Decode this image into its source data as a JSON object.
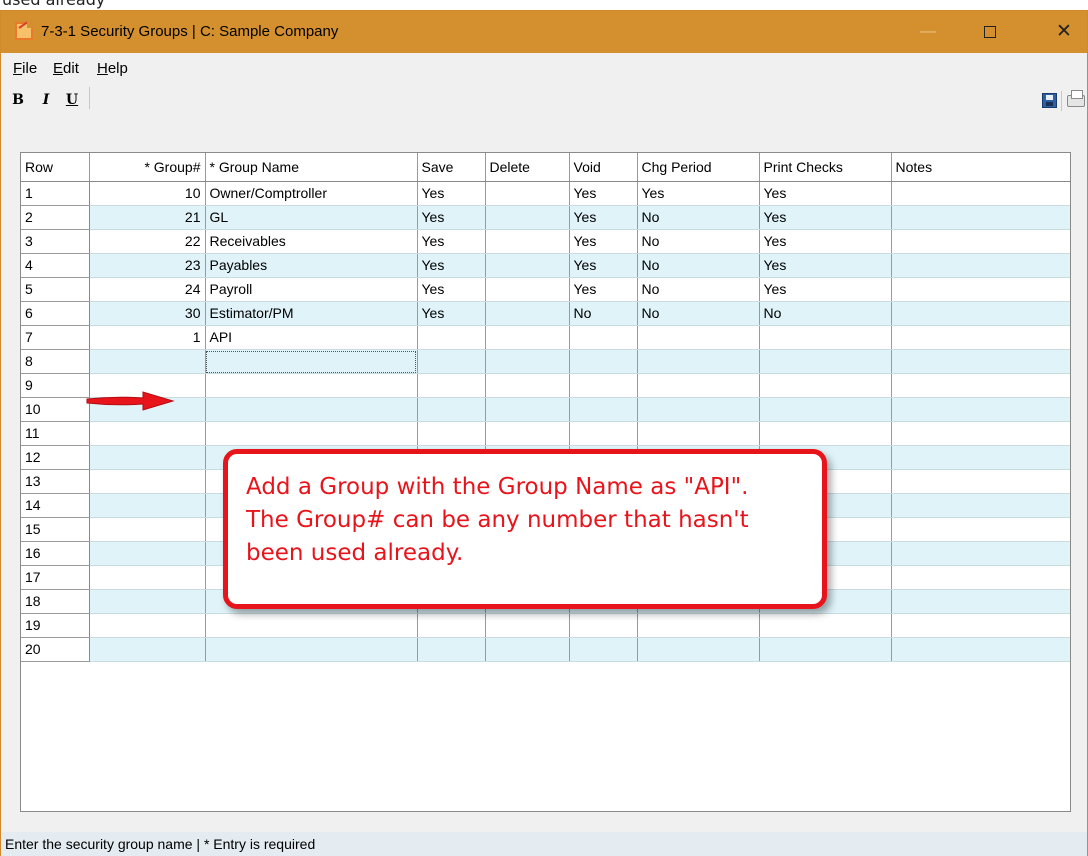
{
  "caption": "used already",
  "window": {
    "title": "7-3-1 Security Groups  |  C: Sample Company",
    "minimize_symbol": "—",
    "close_symbol": "✕"
  },
  "menu": {
    "items": [
      "File",
      "Edit",
      "Help"
    ]
  },
  "toolbar": {
    "bold": "B",
    "italic": "I",
    "underline": "U",
    "icons": [
      "save-icon",
      "print-icon"
    ]
  },
  "grid": {
    "columns": [
      "Row",
      "* Group#",
      "* Group Name",
      "Save",
      "Delete",
      "Void",
      "Chg Period",
      "Print Checks",
      "Notes"
    ],
    "rows": [
      {
        "row": "1",
        "group": "10",
        "name": "Owner/Comptroller",
        "save": "Yes",
        "delete": "",
        "void": "Yes",
        "chg": "Yes",
        "print": "Yes",
        "notes": ""
      },
      {
        "row": "2",
        "group": "21",
        "name": "GL",
        "save": "Yes",
        "delete": "",
        "void": "Yes",
        "chg": "No",
        "print": "Yes",
        "notes": ""
      },
      {
        "row": "3",
        "group": "22",
        "name": "Receivables",
        "save": "Yes",
        "delete": "",
        "void": "Yes",
        "chg": "No",
        "print": "Yes",
        "notes": ""
      },
      {
        "row": "4",
        "group": "23",
        "name": "Payables",
        "save": "Yes",
        "delete": "",
        "void": "Yes",
        "chg": "No",
        "print": "Yes",
        "notes": ""
      },
      {
        "row": "5",
        "group": "24",
        "name": "Payroll",
        "save": "Yes",
        "delete": "",
        "void": "Yes",
        "chg": "No",
        "print": "Yes",
        "notes": ""
      },
      {
        "row": "6",
        "group": "30",
        "name": "Estimator/PM",
        "save": "Yes",
        "delete": "",
        "void": "No",
        "chg": "No",
        "print": "No",
        "notes": ""
      },
      {
        "row": "7",
        "group": "1",
        "name": "API",
        "save": "",
        "delete": "",
        "void": "",
        "chg": "",
        "print": "",
        "notes": ""
      },
      {
        "row": "8",
        "group": "",
        "name": "",
        "save": "",
        "delete": "",
        "void": "",
        "chg": "",
        "print": "",
        "notes": ""
      },
      {
        "row": "9",
        "group": "",
        "name": "",
        "save": "",
        "delete": "",
        "void": "",
        "chg": "",
        "print": "",
        "notes": ""
      },
      {
        "row": "10",
        "group": "",
        "name": "",
        "save": "",
        "delete": "",
        "void": "",
        "chg": "",
        "print": "",
        "notes": ""
      },
      {
        "row": "11",
        "group": "",
        "name": "",
        "save": "",
        "delete": "",
        "void": "",
        "chg": "",
        "print": "",
        "notes": ""
      },
      {
        "row": "12",
        "group": "",
        "name": "",
        "save": "",
        "delete": "",
        "void": "",
        "chg": "",
        "print": "",
        "notes": ""
      },
      {
        "row": "13",
        "group": "",
        "name": "",
        "save": "",
        "delete": "",
        "void": "",
        "chg": "",
        "print": "",
        "notes": ""
      },
      {
        "row": "14",
        "group": "",
        "name": "",
        "save": "",
        "delete": "",
        "void": "",
        "chg": "",
        "print": "",
        "notes": ""
      },
      {
        "row": "15",
        "group": "",
        "name": "",
        "save": "",
        "delete": "",
        "void": "",
        "chg": "",
        "print": "",
        "notes": ""
      },
      {
        "row": "16",
        "group": "",
        "name": "",
        "save": "",
        "delete": "",
        "void": "",
        "chg": "",
        "print": "",
        "notes": ""
      },
      {
        "row": "17",
        "group": "",
        "name": "",
        "save": "",
        "delete": "",
        "void": "",
        "chg": "",
        "print": "",
        "notes": ""
      },
      {
        "row": "18",
        "group": "",
        "name": "",
        "save": "",
        "delete": "",
        "void": "",
        "chg": "",
        "print": "",
        "notes": ""
      },
      {
        "row": "19",
        "group": "",
        "name": "",
        "save": "",
        "delete": "",
        "void": "",
        "chg": "",
        "print": "",
        "notes": ""
      },
      {
        "row": "20",
        "group": "",
        "name": "",
        "save": "",
        "delete": "",
        "void": "",
        "chg": "",
        "print": "",
        "notes": ""
      }
    ],
    "focused_row": 8
  },
  "callout": {
    "lines": [
      "Add a Group with the Group Name as \"API\".",
      "The Group# can be any number that hasn't",
      "been used already."
    ]
  },
  "status": {
    "text": "Enter the security group name  |  * Entry is required"
  },
  "colors": {
    "titlebar": "#d4902f",
    "row_stripe": "#dff3f9",
    "callout_red": "#e8141c"
  }
}
